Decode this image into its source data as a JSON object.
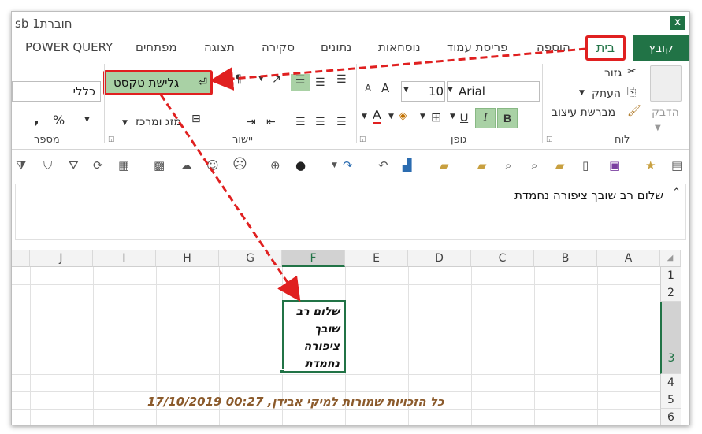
{
  "titlebar": {
    "title": "חוברת1 sb",
    "app_icon": "X"
  },
  "tabs": {
    "file": "קובץ",
    "home": "בית",
    "insert": "הוספה",
    "page_layout": "פריסת עמוד",
    "formulas": "נוסחאות",
    "data": "נתונים",
    "review": "סקירה",
    "view": "תצוגה",
    "developer": "מפתחים",
    "power_query": "POWER QUERY"
  },
  "ribbon": {
    "clipboard": {
      "label": "לוח",
      "paste": "הדבק",
      "cut": "גזור",
      "copy": "העתק",
      "format_painter": "מברשת עיצוב"
    },
    "font": {
      "label": "גופן",
      "font_name": "Arial",
      "font_size": "10",
      "bold": "B",
      "italic": "I",
      "underline": "U"
    },
    "alignment": {
      "label": "יישור",
      "wrap_text": "גלישת טקסט",
      "merge_center": "מזג ומרכז"
    },
    "number": {
      "label": "מספר",
      "format": "כללי",
      "percent": "%",
      "comma": ","
    }
  },
  "formula_bar": {
    "content": "שלום רב שובך ציפורה נחמדת"
  },
  "grid": {
    "columns": [
      "A",
      "B",
      "C",
      "D",
      "E",
      "F",
      "G",
      "H",
      "I",
      "J"
    ],
    "rows": [
      "1",
      "2",
      "3",
      "4",
      "5",
      "6"
    ],
    "selected_column": "F",
    "selected_row": "3",
    "cell_f3_lines": [
      "שלום רב",
      "שובך",
      "ציפורה",
      "נחמדת"
    ]
  },
  "watermark": "כל הזכויות שמורות למיקי אבידן, 00:27 17/10/2019",
  "colors": {
    "excel_green": "#217346",
    "highlight_red": "#e02020",
    "wrap_btn_bg": "#a9d1a5"
  }
}
